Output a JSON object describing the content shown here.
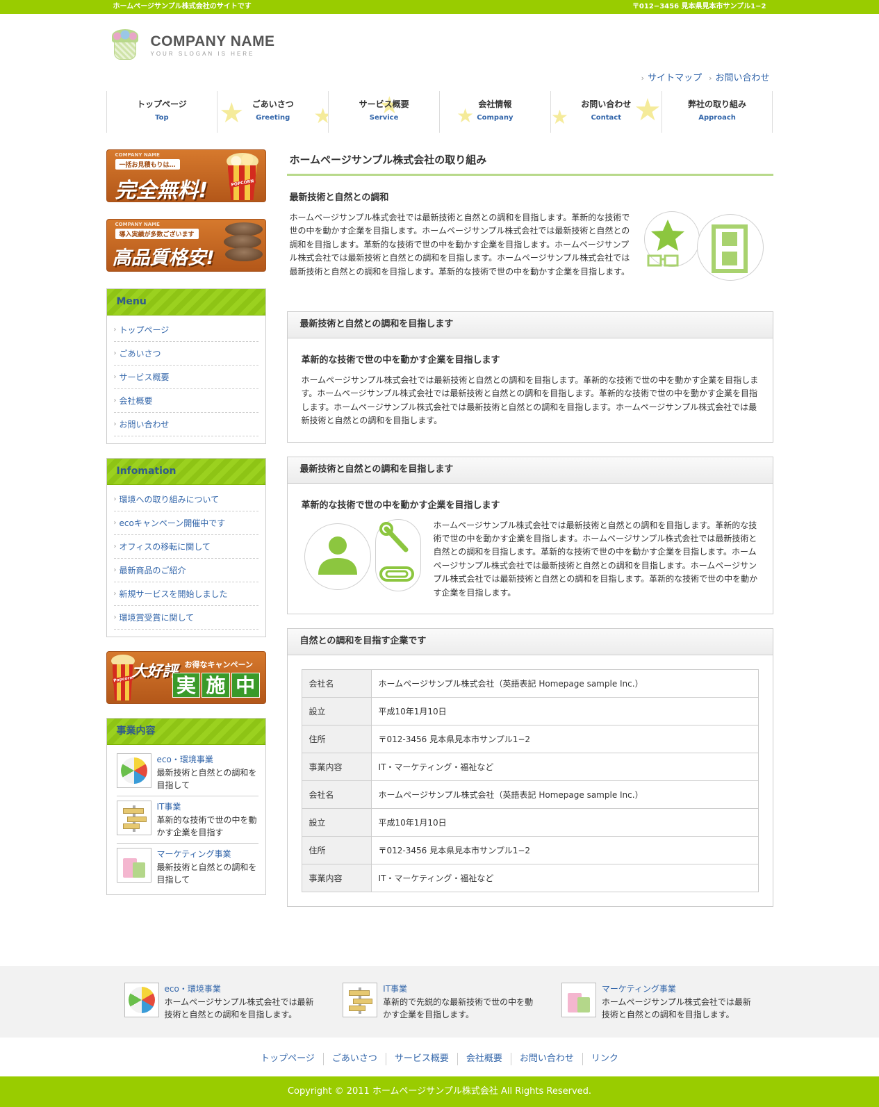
{
  "topbar": {
    "left": "ホームページサンプル株式会社のサイトです",
    "right": "〒012−3456 見本県見本市サンプル1−2"
  },
  "logo": {
    "name": "COMPANY NAME",
    "slogan": "YOUR SLOGAN IS HERE"
  },
  "header_links": [
    "サイトマップ",
    "お問い合わせ"
  ],
  "gnav": [
    {
      "jp": "トップページ",
      "en": "Top"
    },
    {
      "jp": "ごあいさつ",
      "en": "Greeting"
    },
    {
      "jp": "サービス概要",
      "en": "Service"
    },
    {
      "jp": "会社情報",
      "en": "Company"
    },
    {
      "jp": "お問い合わせ",
      "en": "Contact"
    },
    {
      "jp": "弊社の取り組み",
      "en": "Approach"
    }
  ],
  "banners": {
    "free": {
      "company": "COMPANY NAME",
      "sub": "一括お見積もりは…",
      "main": "完全無料!",
      "pic_label": "POPCORN"
    },
    "quality": {
      "company": "COMPANY NAME",
      "sub": "導入実績が多数ございます",
      "main": "高品質格安!"
    },
    "campaign": {
      "title": "大好評",
      "sub": "お得なキャンペーン",
      "main": [
        "実",
        "施",
        "中"
      ],
      "pic_label": "Popcorn"
    }
  },
  "sidebar": {
    "menu": {
      "title": "Menu",
      "items": [
        "トップページ",
        "ごあいさつ",
        "サービス概要",
        "会社概要",
        "お問い合わせ"
      ]
    },
    "info": {
      "title": "Infomation",
      "items": [
        "環境への取り組みについて",
        "ecoキャンペーン開催中です",
        "オフィスの移転に関して",
        "最新商品のご紹介",
        "新規サービスを開始しました",
        "環境賞受賞に関して"
      ]
    },
    "biz": {
      "title": "事業内容",
      "items": [
        {
          "title": "eco・環境事業",
          "desc": "最新技術と自然との調和を目指して",
          "icon": "beach-ball-icon"
        },
        {
          "title": "IT事業",
          "desc": "革新的な技術で世の中を動かす企業を目指す",
          "icon": "signpost-icon"
        },
        {
          "title": "マーケティング事業",
          "desc": "最新技術と自然との調和を目指して",
          "icon": "shopping-bags-icon"
        }
      ]
    }
  },
  "main": {
    "title": "ホームページサンプル株式会社の取り組み",
    "intro": {
      "heading": "最新技術と自然との調和",
      "text": "ホームページサンプル株式会社では最新技術と自然との調和を目指します。革新的な技術で世の中を動かす企業を目指します。ホームページサンプル株式会社では最新技術と自然との調和を目指します。革新的な技術で世の中を動かす企業を目指します。ホームページサンプル株式会社では最新技術と自然との調和を目指します。ホームページサンプル株式会社では最新技術と自然との調和を目指します。革新的な技術で世の中を動かす企業を目指します。"
    },
    "panel1": {
      "title": "最新技術と自然との調和を目指します",
      "sub": "革新的な技術で世の中を動かす企業を目指します",
      "text": "ホームページサンプル株式会社では最新技術と自然との調和を目指します。革新的な技術で世の中を動かす企業を目指します。ホームページサンプル株式会社では最新技術と自然との調和を目指します。革新的な技術で世の中を動かす企業を目指します。ホームページサンプル株式会社では最新技術と自然との調和を目指します。ホームページサンプル株式会社では最新技術と自然との調和を目指します。"
    },
    "panel2": {
      "title": "最新技術と自然との調和を目指します",
      "sub": "革新的な技術で世の中を動かす企業を目指します",
      "text": "ホームページサンプル株式会社では最新技術と自然との調和を目指します。革新的な技術で世の中を動かす企業を目指します。ホームページサンプル株式会社では最新技術と自然との調和を目指します。革新的な技術で世の中を動かす企業を目指します。ホームページサンプル株式会社では最新技術と自然との調和を目指します。ホームページサンプル株式会社では最新技術と自然との調和を目指します。革新的な技術で世の中を動かす企業を目指します。"
    },
    "panel3": {
      "title": "自然との調和を目指す企業です",
      "rows": [
        [
          "会社名",
          "ホームページサンプル株式会社（英語表記 Homepage sample Inc.）"
        ],
        [
          "設立",
          "平成10年1月10日"
        ],
        [
          "住所",
          "〒012-3456 見本県見本市サンプル1−2"
        ],
        [
          "事業内容",
          "IT・マーケティング・福祉など"
        ],
        [
          "会社名",
          "ホームページサンプル株式会社（英語表記 Homepage sample Inc.）"
        ],
        [
          "設立",
          "平成10年1月10日"
        ],
        [
          "住所",
          "〒012-3456 見本県見本市サンプル1−2"
        ],
        [
          "事業内容",
          "IT・マーケティング・福祉など"
        ]
      ]
    }
  },
  "footer": {
    "biz": [
      {
        "title": "eco・環境事業",
        "desc": "ホームページサンプル株式会社では最新技術と自然との調和を目指します。",
        "icon": "beach-ball-icon"
      },
      {
        "title": "IT事業",
        "desc": "革新的で先鋭的な最新技術で世の中を動かす企業を目指します。",
        "icon": "signpost-icon"
      },
      {
        "title": "マーケティング事業",
        "desc": "ホームページサンプル株式会社では最新技術と自然との調和を目指します。",
        "icon": "shopping-bags-icon"
      }
    ],
    "nav": [
      "トップページ",
      "ごあいさつ",
      "サービス概要",
      "会社概要",
      "お問い合わせ",
      "リンク"
    ],
    "copyright": "Copyright © 2011 ホームページサンプル株式会社 All Rights Reserved."
  },
  "colors": {
    "accent": "#99cc00",
    "link": "#3366aa",
    "illustration": "#a8d26e"
  }
}
